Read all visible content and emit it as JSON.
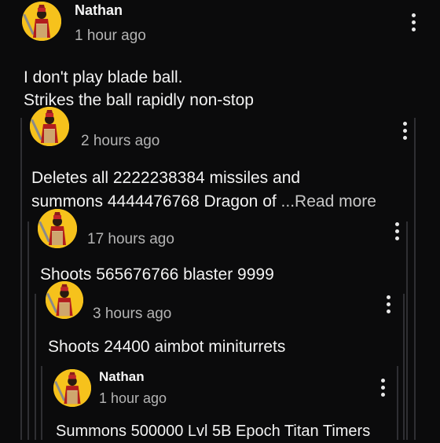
{
  "comments": [
    {
      "author": "Nathan",
      "time": "1 hour ago",
      "lines": [
        "I don't play blade ball.",
        "Strikes the ball rapidly non-stop"
      ]
    },
    {
      "author": "",
      "time": "2 hours ago",
      "lines": [
        "Deletes all 2222238384 missiles and",
        "summons 4444476768 Dragon of "
      ],
      "read_more": "...Read more"
    },
    {
      "author": "",
      "time": "17 hours ago",
      "lines": [
        "Shoots 565676766 blaster 9999"
      ]
    },
    {
      "author": "",
      "time": "3 hours ago",
      "lines": [
        "Shoots 24400 aimbot miniturrets"
      ]
    },
    {
      "author": "Nathan",
      "time": "1 hour ago",
      "lines": [
        "Summons 500000 Lvl 5B Epoch Titan Timers"
      ]
    }
  ],
  "colors": {
    "background": "#0b0b0c",
    "avatar": "#f6c21c",
    "thread_line": "#2f2f33"
  },
  "icons": {
    "menu": "more-vertical-icon",
    "avatar": "avatar-icon"
  }
}
